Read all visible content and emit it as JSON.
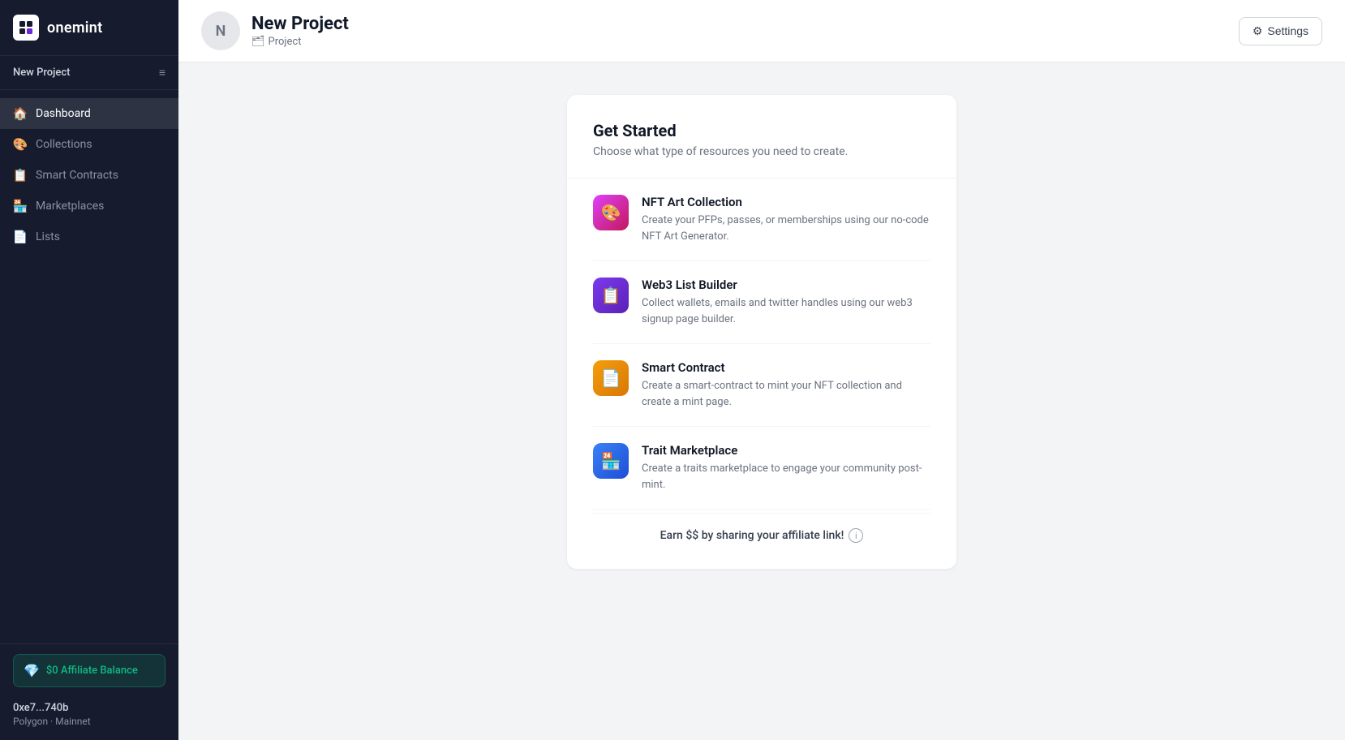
{
  "sidebar": {
    "logo_text": "onemint",
    "project_name": "New Project",
    "nav_items": [
      {
        "id": "dashboard",
        "label": "Dashboard",
        "icon": "🏠",
        "active": true
      },
      {
        "id": "collections",
        "label": "Collections",
        "icon": "🎨",
        "active": false
      },
      {
        "id": "smart-contracts",
        "label": "Smart Contracts",
        "icon": "📋",
        "active": false
      },
      {
        "id": "marketplaces",
        "label": "Marketplaces",
        "icon": "🏪",
        "active": false
      },
      {
        "id": "lists",
        "label": "Lists",
        "icon": "📄",
        "active": false
      }
    ],
    "affiliate_balance": "$0 Affiliate Balance",
    "wallet_address": "0xe7...740b",
    "wallet_network": "Polygon · Mainnet"
  },
  "header": {
    "project_avatar_letter": "N",
    "project_title": "New Project",
    "project_type": "Project",
    "settings_label": "Settings"
  },
  "main": {
    "card": {
      "title": "Get Started",
      "subtitle": "Choose what type of resources you need to create.",
      "resources": [
        {
          "id": "nft-art-collection",
          "title": "NFT Art Collection",
          "description": "Create your PFPs, passes, or memberships using our no-code NFT Art Generator.",
          "icon_color": "pink"
        },
        {
          "id": "web3-list-builder",
          "title": "Web3 List Builder",
          "description": "Collect wallets, emails and twitter handles using our web3 signup page builder.",
          "icon_color": "purple"
        },
        {
          "id": "smart-contract",
          "title": "Smart Contract",
          "description": "Create a smart-contract to mint your NFT collection and create a mint page.",
          "icon_color": "yellow"
        },
        {
          "id": "trait-marketplace",
          "title": "Trait Marketplace",
          "description": "Create a traits marketplace to engage your community post-mint.",
          "icon_color": "blue"
        }
      ],
      "affiliate_text": "Earn $$ by sharing your affiliate link!"
    }
  }
}
